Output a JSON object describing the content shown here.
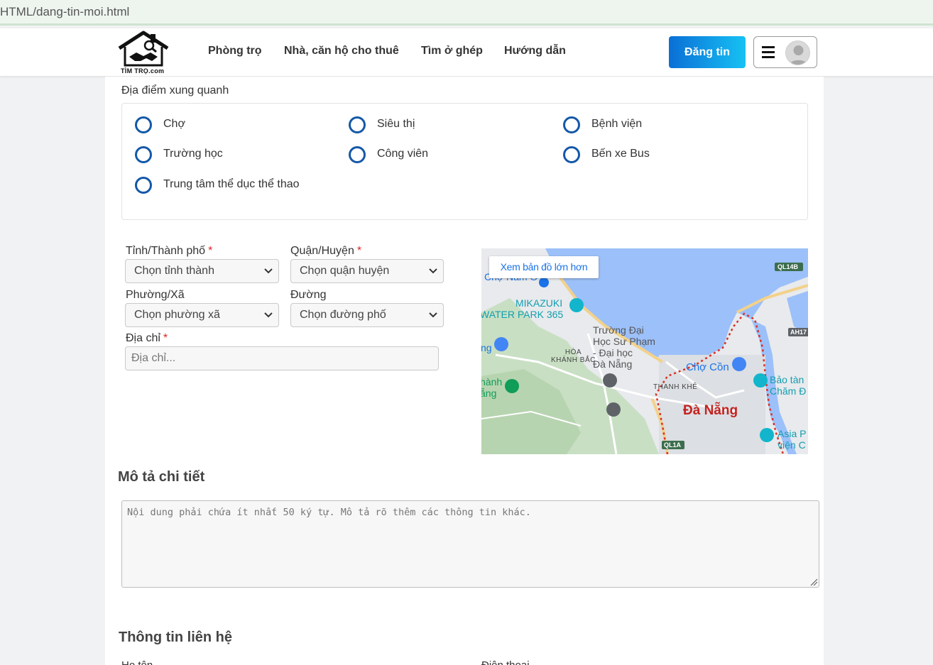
{
  "browser": {
    "url": "HTML/dang-tin-moi.html"
  },
  "header": {
    "logo_text": "TÌM TRỌ.com",
    "nav": [
      "Phòng trọ",
      "Nhà, căn hộ cho thuê",
      "Tìm ở ghép",
      "Hướng dẫn"
    ],
    "post_button": "Đăng tin"
  },
  "amenities": {
    "title": "Địa điểm xung quanh",
    "items": [
      "Chợ",
      "Siêu thị",
      "Bệnh viện",
      "Trường học",
      "Công viên",
      "Bến xe Bus",
      "Trung tâm thể dục thể thao"
    ]
  },
  "location": {
    "province": {
      "label": "Tỉnh/Thành phố",
      "required": "*",
      "value": "Chọn tỉnh thành"
    },
    "district": {
      "label": "Quận/Huyện",
      "required": "*",
      "value": "Chọn quận huyện"
    },
    "ward": {
      "label": "Phường/Xã",
      "value": "Chọn phường xã"
    },
    "street": {
      "label": "Đường",
      "value": "Chọn đường phố"
    },
    "address": {
      "label": "Địa chỉ",
      "required": "*",
      "placeholder": "Địa chỉ..."
    }
  },
  "map": {
    "button": "Xem bản đồ lớn hơn",
    "labels": {
      "city": "Đà Nẵng",
      "mikazuki_1": "MIKAZUKI",
      "mikazuki_2": "WATER PARK 365",
      "cho_nam_o": "Chợ Nam Ô",
      "university_1": "Trường Đại",
      "university_2": "Học Sư Phạm",
      "university_3": "- Đại học",
      "university_4": "Đà Nẵng",
      "hoa_khanh_1": "HÒA",
      "hoa_khanh_2": "KHÁNH BẮC",
      "thanh_khe": "THANH KHÊ",
      "cho_con": "Chợ Cồn",
      "bao_tang_1": "Bảo tàn",
      "bao_tang_2": "Chăm Đ",
      "asia_1": "Asia P",
      "asia_2": "viện C",
      "left_1": "hành",
      "left_2": "ẵng",
      "left_3": "ng",
      "road_ql14b": "QL14B",
      "road_ah17": "AH17",
      "road_ql1a": "QL1A"
    }
  },
  "description": {
    "title": "Mô tả chi tiết",
    "placeholder": "Nội dung phải chứa ít nhất 50 ký tự. Mô tả rõ thêm các thông tin khác."
  },
  "contact": {
    "title": "Thông tin liên hệ",
    "name_label": "Họ tên",
    "phone_label": "Điện thoại"
  },
  "colors": {
    "accent": "#1458a8",
    "button_start": "#0a6fd6",
    "button_end": "#17c1f4",
    "required": "#e02424",
    "map_water": "#9cc0f9"
  }
}
